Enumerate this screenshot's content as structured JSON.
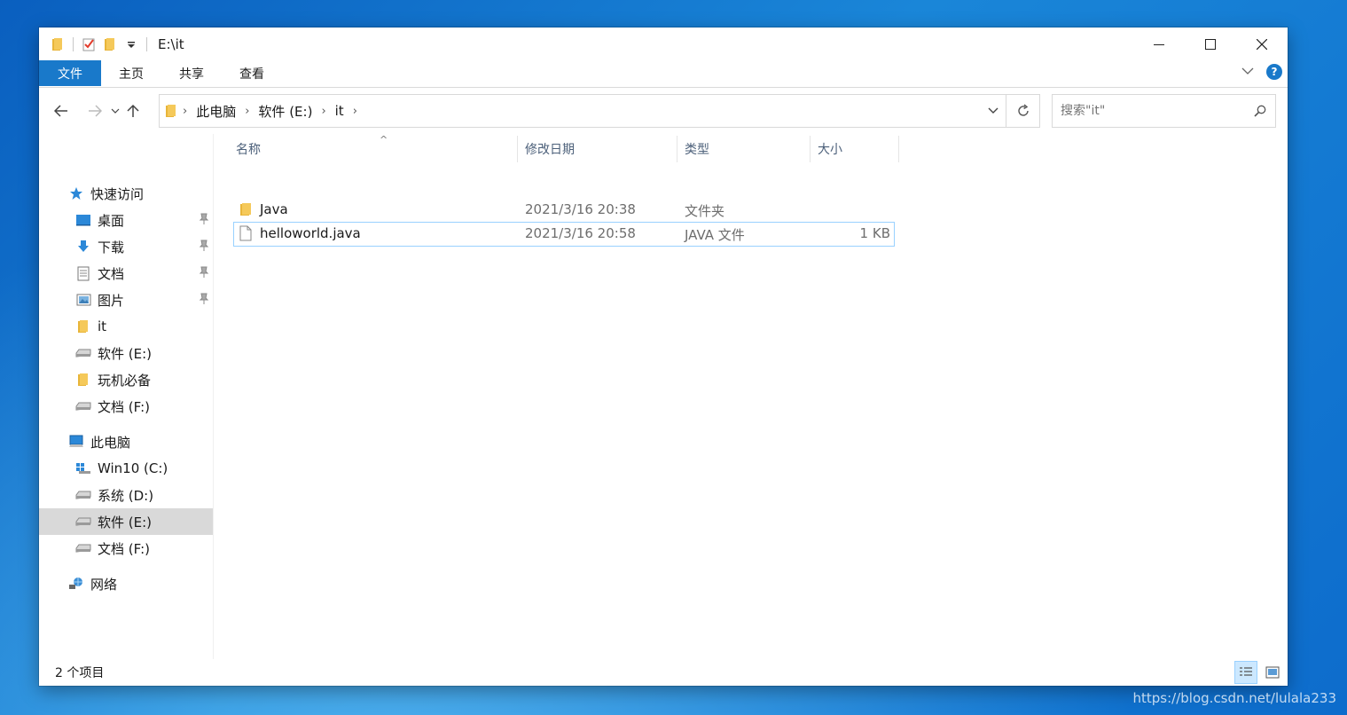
{
  "window": {
    "title": "E:\\it"
  },
  "ribbon": {
    "tabs": [
      "文件",
      "主页",
      "共享",
      "查看"
    ],
    "help": "?"
  },
  "nav": {
    "breadcrumb": [
      "此电脑",
      "软件 (E:)",
      "it"
    ],
    "search_placeholder": "搜索\"it\""
  },
  "sidebar": {
    "quick_access": "快速访问",
    "quick_items": [
      {
        "label": "桌面",
        "icon": "desktop-icon",
        "pinned": true
      },
      {
        "label": "下载",
        "icon": "download-icon",
        "pinned": true
      },
      {
        "label": "文档",
        "icon": "document-icon",
        "pinned": true
      },
      {
        "label": "图片",
        "icon": "picture-icon",
        "pinned": true
      },
      {
        "label": "it",
        "icon": "folder-icon",
        "pinned": false
      },
      {
        "label": "软件 (E:)",
        "icon": "drive-icon",
        "pinned": false
      },
      {
        "label": "玩机必备",
        "icon": "folder-icon",
        "pinned": false
      },
      {
        "label": "文档 (F:)",
        "icon": "drive-icon",
        "pinned": false
      }
    ],
    "this_pc": "此电脑",
    "pc_items": [
      {
        "label": "Win10 (C:)",
        "icon": "windows-drive-icon"
      },
      {
        "label": "系统 (D:)",
        "icon": "drive-icon"
      },
      {
        "label": "软件 (E:)",
        "icon": "drive-icon",
        "selected": true
      },
      {
        "label": "文档 (F:)",
        "icon": "drive-icon"
      }
    ],
    "network": "网络"
  },
  "columns": {
    "name": "名称",
    "modified": "修改日期",
    "type": "类型",
    "size": "大小"
  },
  "files": [
    {
      "name": "Java",
      "modified": "2021/3/16 20:38",
      "type": "文件夹",
      "size": "",
      "icon": "folder-icon"
    },
    {
      "name": "helloworld.java",
      "modified": "2021/3/16 20:58",
      "type": "JAVA 文件",
      "size": "1 KB",
      "icon": "file-icon"
    }
  ],
  "status": {
    "item_count": "2 个项目"
  },
  "watermark": "https://blog.csdn.net/lulala233",
  "colors": {
    "accent": "#1979ca",
    "selection": "#d9d9d9",
    "focus_border": "#99d1ff",
    "folder": "#f5c342"
  }
}
